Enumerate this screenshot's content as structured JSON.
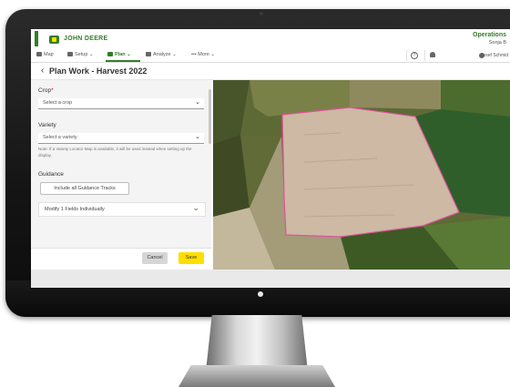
{
  "header": {
    "brand": "JOHN DEERE",
    "org": "Operations",
    "user_short": "Sonja B"
  },
  "nav": {
    "items": [
      {
        "label": "Map",
        "icon": "person-icon"
      },
      {
        "label": "Setup ⌄",
        "icon": "setup-icon"
      },
      {
        "label": "Plan ⌄",
        "icon": "plan-icon"
      },
      {
        "label": "Analyze ⌄",
        "icon": "chart-icon"
      },
      {
        "label": "••• More ⌄",
        "icon": "more-icon"
      }
    ],
    "user_full": "Josef Schmid"
  },
  "page": {
    "title": "Plan Work - Harvest 2022"
  },
  "form": {
    "crop_label": "Crop",
    "crop_required": "*",
    "crop_placeholder": "Select a crop",
    "variety_label": "Variety",
    "variety_placeholder": "Select a variety",
    "note": "Note: If a Variety Locator Map is available, it will be used instead when setting up the display.",
    "guidance_label": "Guidance",
    "guidance_button": "Include all Guidance Tracks",
    "modify_label": "Modify 1 Fields Individually"
  },
  "actions": {
    "cancel": "Cancel",
    "save": "Save"
  },
  "colors": {
    "brand_green": "#367c2b",
    "brand_yellow": "#ffde00",
    "field_boundary": "#e0519a"
  }
}
